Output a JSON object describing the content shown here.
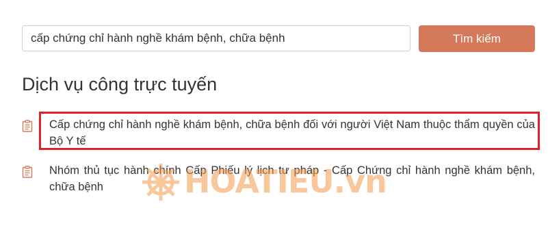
{
  "search": {
    "value": "cấp chứng chỉ hành nghề khám bệnh, chữa bệnh",
    "button_label": "Tìm kiếm"
  },
  "section": {
    "title": "Dịch vụ công trực tuyến"
  },
  "results": [
    {
      "label": "Cấp chứng chỉ hành nghề khám bệnh, chữa bệnh đối với người Việt Nam thuộc thẩm quyền của Bộ Y tế",
      "icon": "document-icon",
      "highlighted": true
    },
    {
      "label": "Nhóm thủ tục hành chính Cấp Phiếu lý lịch tư pháp - Cấp Chứng chỉ hành nghề khám bệnh, chữa bệnh",
      "icon": "document-icon",
      "highlighted": false
    }
  ],
  "watermark": {
    "text": "HOATIEU.vn"
  },
  "colors": {
    "button": "#d4795a",
    "highlight_border": "#e0202a",
    "icon": "#d4795a",
    "watermark": "#f39a4a"
  }
}
